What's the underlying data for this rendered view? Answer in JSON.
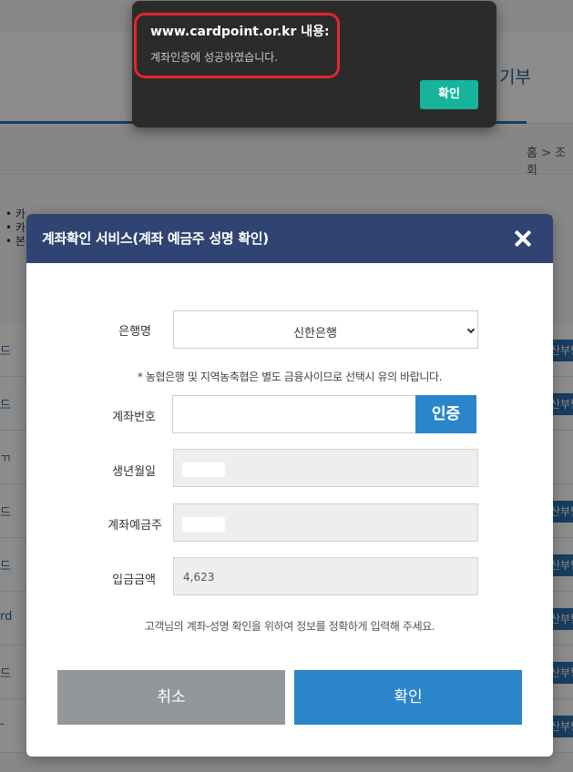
{
  "background": {
    "menu_tail": "기부",
    "breadcrumb": "홈 > 조회",
    "notes": [
      "• 카",
      "• 카",
      "• 본"
    ],
    "rows": [
      {
        "left": "드",
        "right": "산부팀"
      },
      {
        "left": "드",
        "right": "산부팀"
      },
      {
        "left": "ㄲ",
        "right": ""
      },
      {
        "left": "드",
        "right": "산부팀"
      },
      {
        "left": "드",
        "right": "산부팀"
      },
      {
        "left": "rd",
        "right": "산부팀"
      },
      {
        "left": "드",
        "right": "산부팀"
      },
      {
        "left": "-",
        "right": "산부팀"
      }
    ]
  },
  "alert": {
    "title": "www.cardpoint.or.kr 내용:",
    "message": "계좌인증에 성공하였습니다.",
    "ok_label": "확인",
    "ok_color": "#17b49b",
    "highlight_color": "#e2262d"
  },
  "modal": {
    "title": "계좌확인 서비스(계좌 예금주 성명 확인)",
    "header_color": "#2f4472",
    "close_icon": "close-icon",
    "bank_label": "은행명",
    "bank_selected": "신한은행",
    "bank_note": "* 농협은행 및 지역농축협은 별도 금융사이므로 선택시 유의 바랍니다.",
    "account_label": "계좌번호",
    "account_value": "",
    "verify_label": "인증",
    "birth_label": "생년월일",
    "holder_label": "계좌예금주",
    "amount_label": "입금금액",
    "amount_value": "4,623",
    "info_text": "고객님의 계좌-성명 확인을 위하여 정보를 정확하게 입력해 주세요.",
    "cancel_label": "취소",
    "confirm_label": "확인",
    "accent_color": "#2a86c9"
  }
}
